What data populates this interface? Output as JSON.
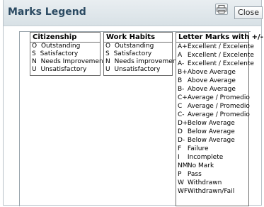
{
  "dialog": {
    "title": "Marks Legend",
    "print_icon": "printer-icon",
    "close_label": "Close"
  },
  "citizenship": {
    "header": "Citizenship",
    "items": [
      {
        "code": "O",
        "label": "Outstanding"
      },
      {
        "code": "S",
        "label": "Satisfactory"
      },
      {
        "code": "N",
        "label": "Needs Improvement"
      },
      {
        "code": "U",
        "label": "Unsatisfactory"
      }
    ]
  },
  "work_habits": {
    "header": "Work Habits",
    "items": [
      {
        "code": "O",
        "label": "Outstanding"
      },
      {
        "code": "S",
        "label": "Satisfactory"
      },
      {
        "code": "N",
        "label": "Needs improvement"
      },
      {
        "code": "U",
        "label": "Unsatisfactory"
      }
    ]
  },
  "letter_marks": {
    "header": "Letter Marks with +/-",
    "items": [
      {
        "code": "A+",
        "label": "Excellent / Excelente"
      },
      {
        "code": "A",
        "label": "Excellent / Excelente"
      },
      {
        "code": "A-",
        "label": "Excellent / Excelente"
      },
      {
        "code": "B+",
        "label": "Above Average"
      },
      {
        "code": "B",
        "label": "Above Average"
      },
      {
        "code": "B-",
        "label": "Above Average"
      },
      {
        "code": "C+",
        "label": "Average / Promedio"
      },
      {
        "code": "C",
        "label": "Average / Promedio"
      },
      {
        "code": "C-",
        "label": "Average / Promedio"
      },
      {
        "code": "D+",
        "label": "Below Average"
      },
      {
        "code": "D",
        "label": "Below Average"
      },
      {
        "code": "D-",
        "label": "Below Average"
      },
      {
        "code": "F",
        "label": "Failure"
      },
      {
        "code": "I",
        "label": "Incomplete"
      },
      {
        "code": "NM",
        "label": "No Mark"
      },
      {
        "code": "P",
        "label": "Pass"
      },
      {
        "code": "W",
        "label": "Withdrawn"
      },
      {
        "code": "WF",
        "label": "Withdrawn/Fail"
      }
    ]
  }
}
